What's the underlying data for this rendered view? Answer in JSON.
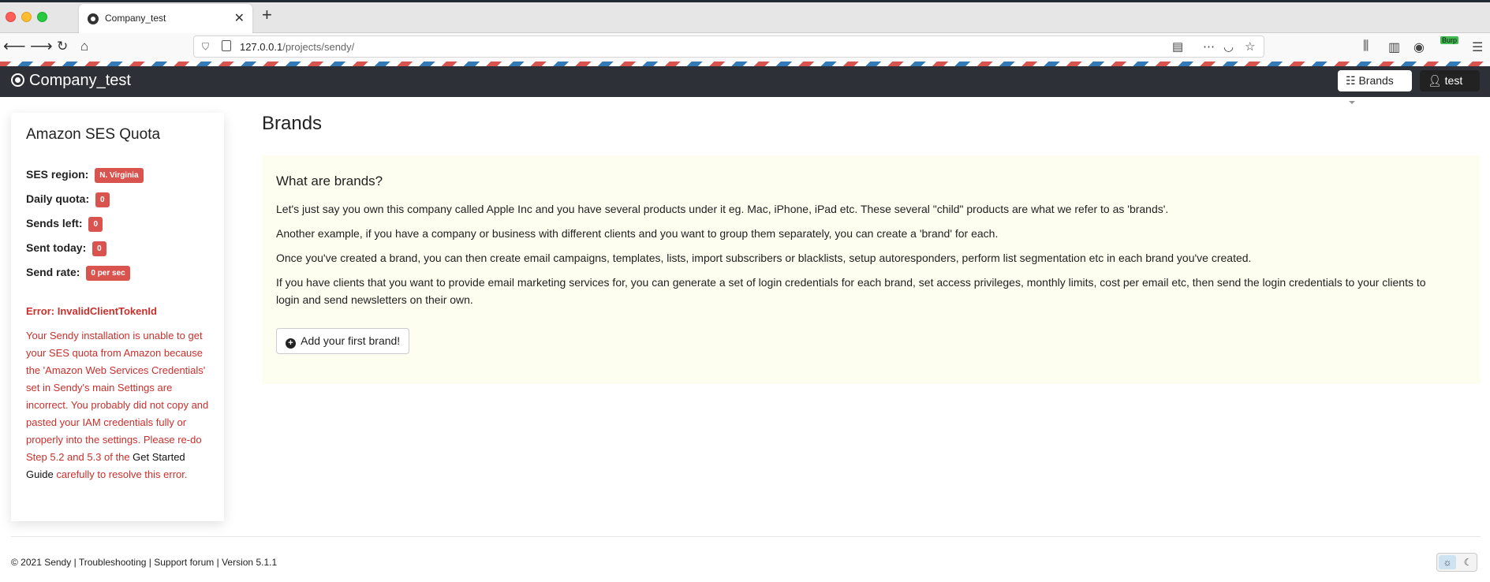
{
  "browser": {
    "tab_title": "Company_test",
    "url_host": "127.0.0.1",
    "url_path": "/projects/sendy/",
    "burp_label": "Burp"
  },
  "header": {
    "app_title": "Company_test",
    "brands_label": "Brands",
    "user_label": "test"
  },
  "sidebar": {
    "title": "Amazon SES Quota",
    "quota": [
      {
        "label": "SES region:",
        "value": "N. Virginia"
      },
      {
        "label": "Daily quota:",
        "value": "0"
      },
      {
        "label": "Sends left:",
        "value": "0"
      },
      {
        "label": "Sent today:",
        "value": "0"
      },
      {
        "label": "Send rate:",
        "value": "0 per sec"
      }
    ],
    "error_title": "Error: InvalidClientTokenId",
    "error_text_1": "Your Sendy installation is unable to get your SES quota from Amazon because the 'Amazon Web Services Credentials' set in Sendy's main Settings are incorrect. You probably did not copy and pasted your IAM credentials fully or properly into the settings. Please re-do Step 5.2 and 5.3 of the ",
    "error_link": "Get Started Guide",
    "error_text_2": " carefully to resolve this error."
  },
  "main": {
    "page_title": "Brands",
    "info_heading": "What are brands?",
    "paragraphs": [
      "Let's just say you own this company called Apple Inc and you have several products under it eg. Mac, iPhone, iPad etc. These several \"child\" products are what we refer to as 'brands'.",
      "Another example, if you have a company or business with different clients and you want to group them separately, you can create a 'brand' for each.",
      "Once you've created a brand, you can then create email campaigns, templates, lists, import subscribers or blacklists, setup autoresponders, perform list segmentation etc in each brand you've created.",
      "If you have clients that you want to provide email marketing services for, you can generate a set of login credentials for each brand, set access privileges, monthly limits, cost per email etc, then send the login credentials to your clients to login and send newsletters on their own."
    ],
    "add_button": "Add your first brand!"
  },
  "footer": {
    "copyright": "© 2021 Sendy",
    "troubleshooting": "Troubleshooting",
    "support": "Support forum",
    "version": "Version 5.1.1",
    "separator": " | "
  },
  "colors": {
    "header_bg": "#2d3037",
    "badge": "#d9534f",
    "error": "#c9302c",
    "info_bg": "#fdfdf0"
  }
}
